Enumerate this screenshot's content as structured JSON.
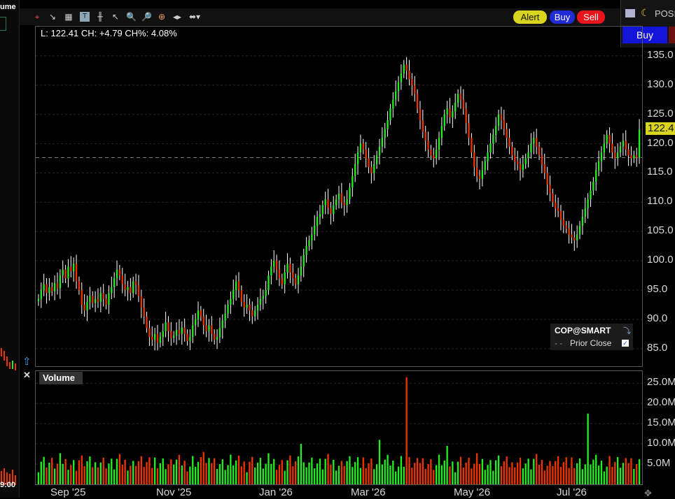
{
  "left_strip": {
    "top_label": "ume",
    "time_label": "9:00"
  },
  "toolbar": {
    "icons": [
      "crosshair-icon",
      "draw-icon",
      "grid-icon",
      "text-icon",
      "bars-icon",
      "cursor-icon",
      "zoom-in-icon",
      "zoom-out-icon",
      "target-icon",
      "fit-icon",
      "split-icon"
    ],
    "alert_label": "Alert",
    "buy_label": "Buy",
    "sell_label": "Sell"
  },
  "right_panel": {
    "position_label": "POSI",
    "buy_label": "Buy"
  },
  "ohlc_readout": "L: 122.41 CH: +4.79 CH%: 4.08%",
  "legend": {
    "symbol": "COP@SMART",
    "prior_close_label": "Prior Close"
  },
  "volume_panel": {
    "title": "Volume"
  },
  "colors": {
    "up": "#22ee22",
    "down": "#ee3300",
    "price_label_bg": "#d9d51e",
    "alert": "#d9d51e",
    "buy": "#1f2bd6",
    "sell": "#e8141c"
  },
  "chart_data": {
    "type": "candlestick",
    "y_ticks": [
      "135.0",
      "130.0",
      "125.0",
      "120.0",
      "115.0",
      "110.0",
      "105.0",
      "100.0",
      "95.0",
      "90.0",
      "85.0"
    ],
    "y_range": [
      82,
      140
    ],
    "last_price_label": "122.4",
    "prior_close": 117.62,
    "x_ticks": [
      "Sep '25",
      "Nov '25",
      "Jan '26",
      "Mar '26",
      "May '26",
      "Jul '26"
    ],
    "volume_ticks": [
      "25.0M",
      "20.0M",
      "15.0M",
      "10.0M",
      "5.0M"
    ],
    "volume_range": [
      0,
      28
    ],
    "closes": [
      93.5,
      95.0,
      96.0,
      94.5,
      95.5,
      94.8,
      96.2,
      95.3,
      97.5,
      98.5,
      97.0,
      99.0,
      98.2,
      99.5,
      96.5,
      95.0,
      92.5,
      91.5,
      93.0,
      94.0,
      92.8,
      93.5,
      93.0,
      94.5,
      93.5,
      92.5,
      94.5,
      95.5,
      97.0,
      98.5,
      97.5,
      96.0,
      95.0,
      95.5,
      94.5,
      96.5,
      95.8,
      94.0,
      92.0,
      90.5,
      88.5,
      87.0,
      86.5,
      87.5,
      86.0,
      87.0,
      88.0,
      89.5,
      88.0,
      86.8,
      87.2,
      88.2,
      87.5,
      88.6,
      87.5,
      86.3,
      87.0,
      89.0,
      90.0,
      91.5,
      90.5,
      89.0,
      88.0,
      89.0,
      87.5,
      86.5,
      87.0,
      88.5,
      89.8,
      91.0,
      92.5,
      93.5,
      95.0,
      96.5,
      95.0,
      93.0,
      92.0,
      92.5,
      91.5,
      90.5,
      91.5,
      92.5,
      93.5,
      94.0,
      95.0,
      97.5,
      99.0,
      100.0,
      98.5,
      97.0,
      96.0,
      98.0,
      99.5,
      98.0,
      97.0,
      96.0,
      97.5,
      99.0,
      101.0,
      102.5,
      103.5,
      104.5,
      106.0,
      107.5,
      108.0,
      109.5,
      110.5,
      109.0,
      108.0,
      109.5,
      110.5,
      111.5,
      110.0,
      109.5,
      110.5,
      112.5,
      114.5,
      116.5,
      118.5,
      120.0,
      119.0,
      117.5,
      116.0,
      115.0,
      116.5,
      118.0,
      119.5,
      121.0,
      122.5,
      124.0,
      126.0,
      127.5,
      129.0,
      130.5,
      132.0,
      133.5,
      132.5,
      131.0,
      130.0,
      128.5,
      126.0,
      124.0,
      122.0,
      120.5,
      119.0,
      118.0,
      117.5,
      119.0,
      121.0,
      123.0,
      125.0,
      126.0,
      124.5,
      125.5,
      127.0,
      128.5,
      127.5,
      126.0,
      123.5,
      121.0,
      118.5,
      116.0,
      114.5,
      114.0,
      115.5,
      117.0,
      118.5,
      120.0,
      121.5,
      123.0,
      125.0,
      124.0,
      122.5,
      121.0,
      119.5,
      118.0,
      117.0,
      116.5,
      115.5,
      116.5,
      117.5,
      118.5,
      120.0,
      121.0,
      119.5,
      118.0,
      116.5,
      115.0,
      113.0,
      111.5,
      110.0,
      109.0,
      108.5,
      107.0,
      106.0,
      105.5,
      104.5,
      104.0,
      103.5,
      104.5,
      106.0,
      107.5,
      109.0,
      110.5,
      112.0,
      113.5,
      115.5,
      117.0,
      118.5,
      120.0,
      121.5,
      120.0,
      118.5,
      117.5,
      118.5,
      119.5,
      120.5,
      119.0,
      118.0,
      117.5,
      118.0,
      117.6,
      122.4
    ]
  }
}
